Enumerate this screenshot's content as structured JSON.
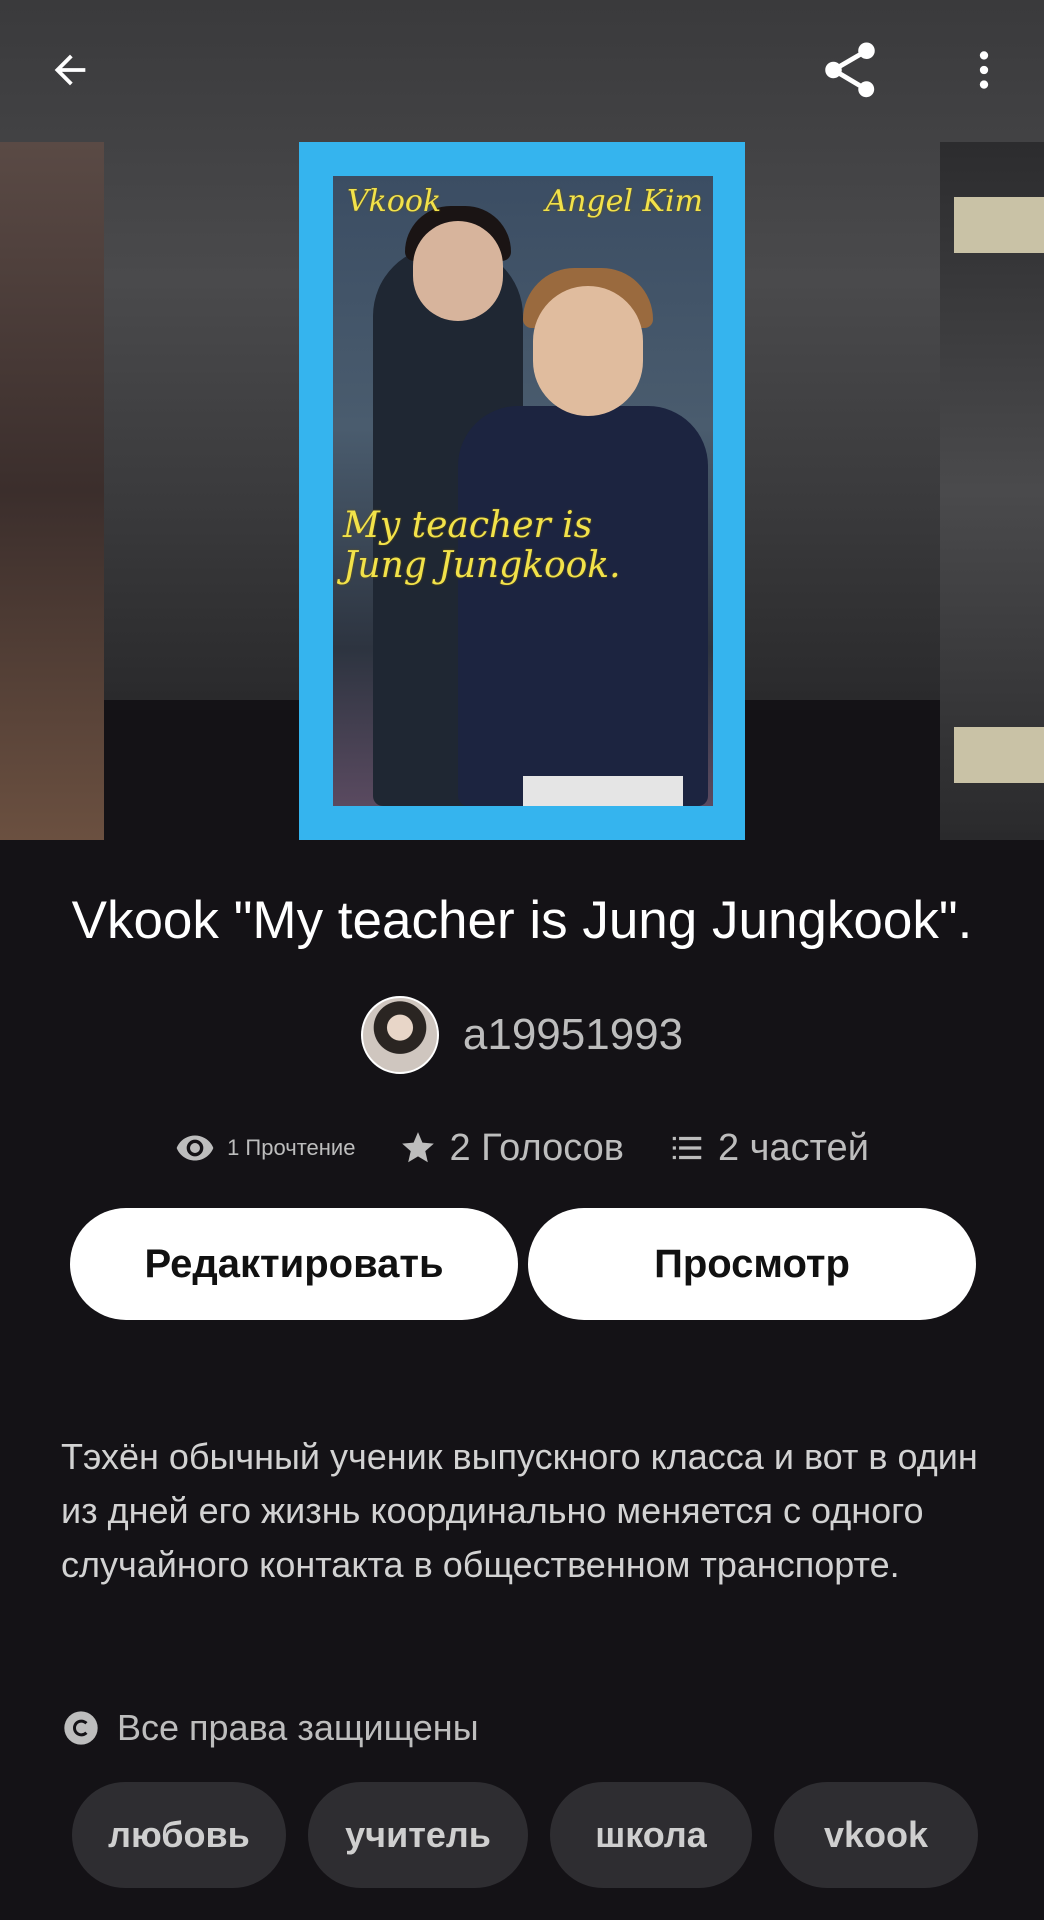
{
  "header": {
    "back_icon": "arrow-left-icon",
    "share_icon": "share-icon",
    "more_icon": "more-vertical-icon"
  },
  "cover": {
    "text_top_left": "Vkook",
    "text_top_right": "Angel Kim",
    "text_title": "My teacher is Jung Jungkook.",
    "frame_color": "#35b4ee"
  },
  "story": {
    "title": "Vkook \"My teacher is Jung Jungkook\".",
    "author": "a19951993"
  },
  "stats": {
    "reads": "1 Прочтение",
    "votes": "2 Голосов",
    "parts": "2 частей"
  },
  "actions": {
    "edit_label": "Редактировать",
    "view_label": "Просмотр"
  },
  "description": "Тэхён обычный ученик выпускного класса и вот в один из дней его жизнь координально меняется с одного случайного контакта в общественном транспорте.",
  "rights": "Все права защищены",
  "tags": [
    "любовь",
    "учитель",
    "школа",
    "vkook"
  ]
}
